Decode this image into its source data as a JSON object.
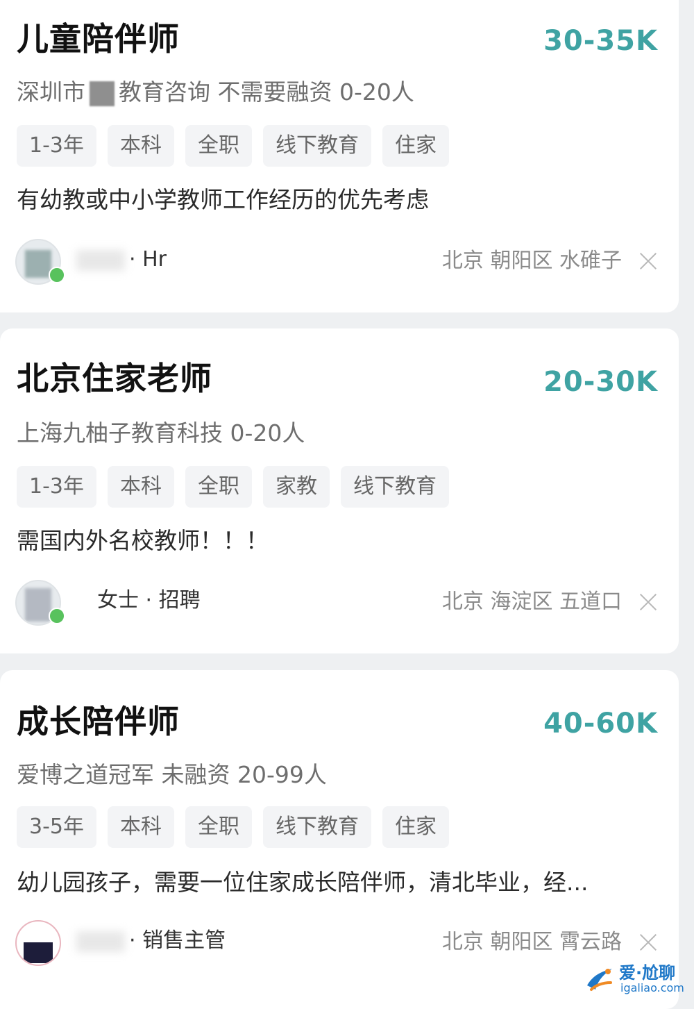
{
  "jobs": [
    {
      "title": "儿童陪伴师",
      "salary": "30-35K",
      "company_before": "深圳市",
      "company_after": "教育咨询 不需要融资 0-20人",
      "tags": [
        "1-3年",
        "本科",
        "全职",
        "线下教育",
        "住家"
      ],
      "description": "有幼教或中小学教师工作经历的优先考虑",
      "hr": "· Hr",
      "location": "北京 朝阳区 水碓子"
    },
    {
      "title": "北京住家老师",
      "salary": "20-30K",
      "company": "上海九柚子教育科技 0-20人",
      "tags": [
        "1-3年",
        "本科",
        "全职",
        "家教",
        "线下教育"
      ],
      "description": "需国内外名校教师！！！",
      "hr": "女士 · 招聘",
      "location": "北京 海淀区 五道口"
    },
    {
      "title": "成长陪伴师",
      "salary": "40-60K",
      "company": "爱博之道冠军 未融资 20-99人",
      "tags": [
        "3-5年",
        "本科",
        "全职",
        "线下教育",
        "住家"
      ],
      "description": "幼儿园孩子，需要一位住家成长陪伴师，清北毕业，经...",
      "hr": "· 销售主管",
      "location": "北京 朝阳区 霄云路"
    }
  ],
  "watermark": {
    "text": "爱·尬聊",
    "url": "igaliao.com"
  },
  "colors": {
    "salary": "#3fa3a3",
    "online_dot": "#58c25d",
    "watermark": "#1f78c8"
  }
}
